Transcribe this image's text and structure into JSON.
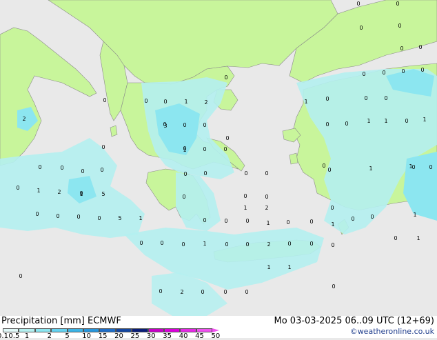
{
  "title": "Precipitation [mm]  ECMWF",
  "valid_time": "Mo 03-03-2025 06..09 UTC (12+69)",
  "credit": "©weatheronline.co.uk",
  "legend": {
    "ticks": [
      "0.1",
      "0.5",
      "1",
      "2",
      "5",
      "10",
      "15",
      "20",
      "25",
      "30",
      "35",
      "40",
      "45",
      "50"
    ],
    "colors": [
      "#e0f8f8",
      "#b4f0f0",
      "#8ce6f0",
      "#64d2f0",
      "#3cb4e6",
      "#2896dc",
      "#1e6ec8",
      "#1446a0",
      "#0a1e78",
      "#c800c8",
      "#dc00dc",
      "#e628e6",
      "#f050f0"
    ]
  },
  "colors": {
    "sea": "#e9e9e9",
    "land": "#c8f59b",
    "precip_light": "#b4f0f0",
    "precip_medium": "#8ce6f0",
    "precip_heavy": "#64d2f0"
  },
  "map_labels": [
    "0",
    "0",
    "0",
    "0",
    "0",
    "0",
    "0",
    "0",
    "0",
    "0",
    "0",
    "2",
    "0",
    "0",
    "1",
    "2",
    "0",
    "1",
    "0",
    "0",
    "0",
    "1",
    "0",
    "1",
    "1",
    "0",
    "0",
    "3",
    "0",
    "0",
    "0",
    "0",
    "0",
    "0",
    "0",
    "0",
    "0",
    "0",
    "0",
    "0",
    "0",
    "1",
    "1",
    "0",
    "0",
    "1",
    "2",
    "0",
    "5",
    "0",
    "0",
    "0",
    "1",
    "2",
    "0",
    "0",
    "0",
    "1",
    "0",
    "0",
    "0",
    "0",
    "5",
    "1",
    "0",
    "0",
    "0",
    "1",
    "0",
    "0",
    "1",
    "0",
    "1",
    "0",
    "0",
    "0",
    "1",
    "0",
    "0",
    "2",
    "0",
    "0",
    "0",
    "1",
    "1",
    "0",
    "2",
    "0",
    "0",
    "0",
    "0",
    "0",
    "0",
    "1",
    "0",
    "1",
    "0",
    "0",
    "0",
    "0"
  ]
}
